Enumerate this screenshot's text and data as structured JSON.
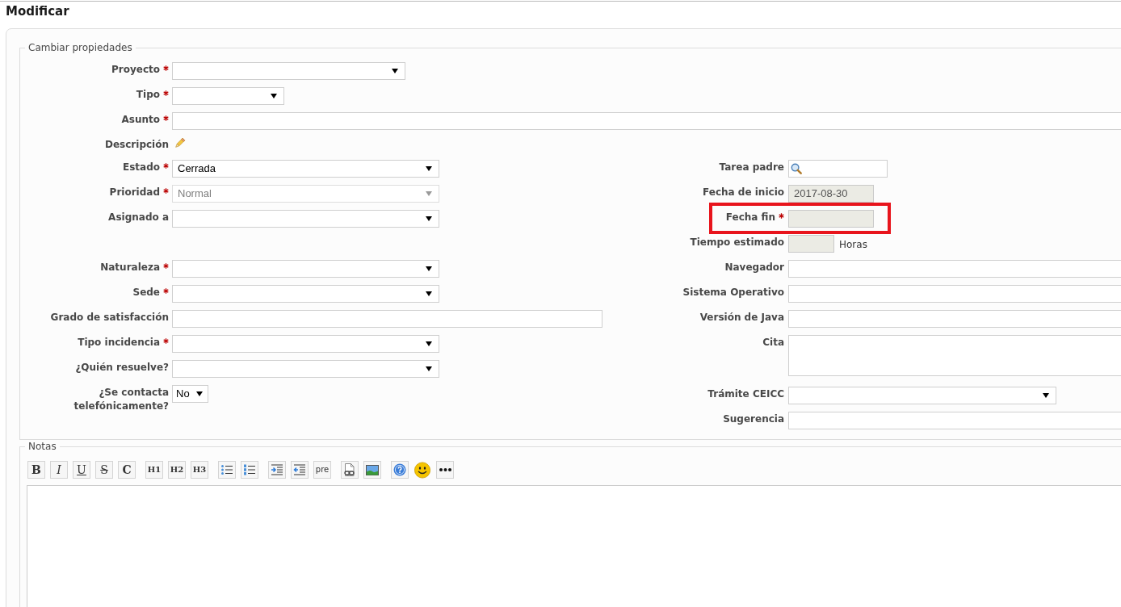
{
  "page": {
    "title": "Modificar"
  },
  "properties": {
    "legend": "Cambiar propiedades",
    "top_fields": [
      {
        "label": "Proyecto",
        "required": true,
        "kind": "select",
        "disabled": false
      },
      {
        "label": "Tipo",
        "required": true,
        "kind": "select",
        "disabled": false
      },
      {
        "label": "Asunto",
        "required": true,
        "kind": "text",
        "disabled": false
      },
      {
        "label": "Descripción",
        "required": false,
        "kind": "edit",
        "disabled": false
      }
    ],
    "attributes": {
      "left": [
        {
          "label": "Estado",
          "required": true,
          "kind": "select",
          "disabled": false,
          "value": "Cerrada"
        },
        {
          "label": "Prioridad",
          "required": true,
          "kind": "select",
          "disabled": true,
          "value": "Normal"
        },
        {
          "label": "Asignado a",
          "required": false,
          "kind": "select",
          "disabled": false
        }
      ],
      "right": [
        {
          "label": "Tarea padre",
          "required": false,
          "kind": "search",
          "disabled": false,
          "highlighted": false
        },
        {
          "label": "Fecha de inicio",
          "required": false,
          "kind": "text",
          "disabled": true,
          "value": "2017-08-30",
          "highlighted": false
        },
        {
          "label": "Fecha fin",
          "required": true,
          "kind": "text",
          "disabled": true,
          "highlighted": true
        },
        {
          "label": "Tiempo estimado",
          "required": false,
          "kind": "text",
          "disabled": true,
          "unit": "Horas",
          "highlighted": false
        }
      ]
    },
    "custom_fields": {
      "left": [
        {
          "label": "Naturaleza",
          "required": true,
          "kind": "select",
          "disabled": false
        },
        {
          "label": "Sede",
          "required": true,
          "kind": "select",
          "disabled": false
        },
        {
          "label": "Grado de satisfacción",
          "required": false,
          "kind": "text",
          "disabled": false
        },
        {
          "label": "Tipo incidencia",
          "required": true,
          "kind": "select",
          "disabled": false
        },
        {
          "label": "¿Quién resuelve?",
          "required": false,
          "kind": "select",
          "disabled": false
        },
        {
          "label": "¿Se contacta telefónicamente?",
          "required": false,
          "kind": "select",
          "disabled": false,
          "value": "No"
        }
      ],
      "right": [
        {
          "label": "Navegador",
          "required": false,
          "kind": "text",
          "disabled": false
        },
        {
          "label": "Sistema Operativo",
          "required": false,
          "kind": "text",
          "disabled": false
        },
        {
          "label": "Versión de Java",
          "required": false,
          "kind": "text",
          "disabled": false
        },
        {
          "label": "Cita",
          "required": false,
          "kind": "textarea",
          "disabled": false
        },
        {
          "label": "Trámite CEICC",
          "required": false,
          "kind": "select",
          "disabled": false
        },
        {
          "label": "Sugerencia",
          "required": false,
          "kind": "text",
          "disabled": false
        }
      ]
    }
  },
  "notes": {
    "legend": "Notas",
    "toolbar": [
      {
        "buttons": [
          {
            "kind": "bold",
            "label": "B"
          },
          {
            "kind": "italic",
            "label": "I"
          },
          {
            "kind": "underline",
            "label": "U"
          },
          {
            "kind": "strike",
            "label": "S"
          },
          {
            "kind": "code",
            "label": "C"
          }
        ]
      },
      {
        "buttons": [
          {
            "kind": "heading",
            "label": "H1"
          },
          {
            "kind": "heading",
            "label": "H2"
          },
          {
            "kind": "heading",
            "label": "H3"
          }
        ]
      },
      {
        "buttons": [
          {
            "kind": "ul"
          },
          {
            "kind": "ol"
          }
        ]
      },
      {
        "buttons": [
          {
            "kind": "indent"
          },
          {
            "kind": "outdent"
          },
          {
            "kind": "pre",
            "label": "pre"
          }
        ]
      },
      {
        "buttons": [
          {
            "kind": "link"
          },
          {
            "kind": "image"
          }
        ]
      },
      {
        "buttons": [
          {
            "kind": "help"
          },
          {
            "kind": "smiley"
          },
          {
            "kind": "more"
          }
        ]
      }
    ]
  }
}
